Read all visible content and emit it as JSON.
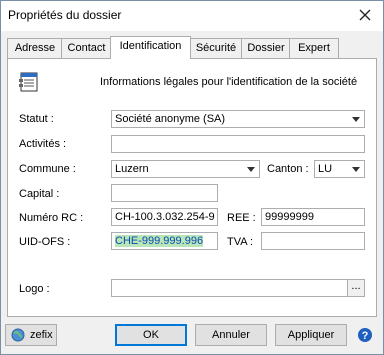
{
  "window": {
    "title": "Propriétés du dossier"
  },
  "tabs": [
    {
      "label": "Adresse"
    },
    {
      "label": "Contact"
    },
    {
      "label": "Identification"
    },
    {
      "label": "Sécurité"
    },
    {
      "label": "Dossier"
    },
    {
      "label": "Expert"
    }
  ],
  "header": {
    "text": "Informations légales pour l'identification de la société"
  },
  "form": {
    "statut": {
      "label": "Statut :",
      "value": "Société anonyme (SA)"
    },
    "activites": {
      "label": "Activités :",
      "value": ""
    },
    "commune": {
      "label": "Commune :",
      "value": "Luzern"
    },
    "canton": {
      "label": "Canton :",
      "value": "LU"
    },
    "capital": {
      "label": "Capital :",
      "value": ""
    },
    "numero_rc": {
      "label": "Numéro RC :",
      "value": "CH-100.3.032.254-9"
    },
    "ree": {
      "label": "REE :",
      "value": "99999999"
    },
    "uid_ofs": {
      "label": "UID-OFS :",
      "value": "CHE-999.999.996"
    },
    "tva": {
      "label": "TVA :",
      "value": ""
    },
    "logo": {
      "label": "Logo :",
      "value": "",
      "browse_label": "..."
    }
  },
  "footer": {
    "zefix_label": "zefix",
    "ok_label": "OK",
    "cancel_label": "Annuler",
    "apply_label": "Appliquer"
  },
  "colors": {
    "selection_bg": "#b8e6b8",
    "selection_text": "#0b4bb3",
    "accent": "#0078d7"
  }
}
